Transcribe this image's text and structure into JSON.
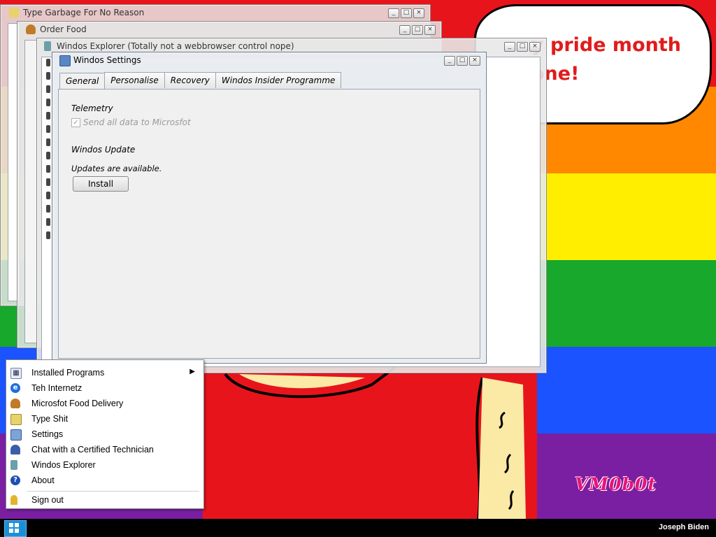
{
  "wallpaper": {
    "stripe_colors": [
      "#e8141c",
      "#ff8800",
      "#ffee00",
      "#17a82c",
      "#1a53ff",
      "#7a1fa2"
    ],
    "speech_bubble_text": "y pride month\none!",
    "watermark": "VM0b0t"
  },
  "windows": {
    "type_garbage": {
      "title": "Type Garbage For No Reason"
    },
    "order_food": {
      "title": "Order Food"
    },
    "explorer": {
      "title": "Windos Explorer (Totally not a webbrowser control nope)"
    },
    "settings": {
      "title": "Windos Settings",
      "tabs": [
        {
          "label": "General",
          "active": true
        },
        {
          "label": "Personalise",
          "active": false
        },
        {
          "label": "Recovery",
          "active": false
        },
        {
          "label": "Windos Insider Programme",
          "active": false
        }
      ],
      "telemetry": {
        "heading": "Telemetry",
        "checkbox_label": "Send all data to Microsfot",
        "checked": true,
        "disabled": true
      },
      "update": {
        "heading": "Windos Update",
        "status": "Updates are available.",
        "button_label": "Install"
      }
    }
  },
  "start_menu": {
    "items": [
      {
        "label": "Installed Programs",
        "icon": "programs-grid-icon",
        "submenu": true
      },
      {
        "label": "Teh Internetz",
        "icon": "internet-explorer-icon"
      },
      {
        "label": "Microsfot Food Delivery",
        "icon": "burger-icon"
      },
      {
        "label": "Type Shit",
        "icon": "notepad-icon"
      },
      {
        "label": "Settings",
        "icon": "settings-icon"
      },
      {
        "label": "Chat with a Certified Technician",
        "icon": "technician-icon"
      },
      {
        "label": "Windos Explorer",
        "icon": "explorer-book-icon"
      },
      {
        "label": "About",
        "icon": "help-icon"
      }
    ],
    "sign_out": {
      "label": "Sign out",
      "icon": "key-icon"
    }
  },
  "taskbar": {
    "user": "Joseph Biden"
  },
  "colors": {
    "menu_highlight": "#cce4f7",
    "taskbar": "#000000",
    "start_button": "#1a8fd8"
  }
}
